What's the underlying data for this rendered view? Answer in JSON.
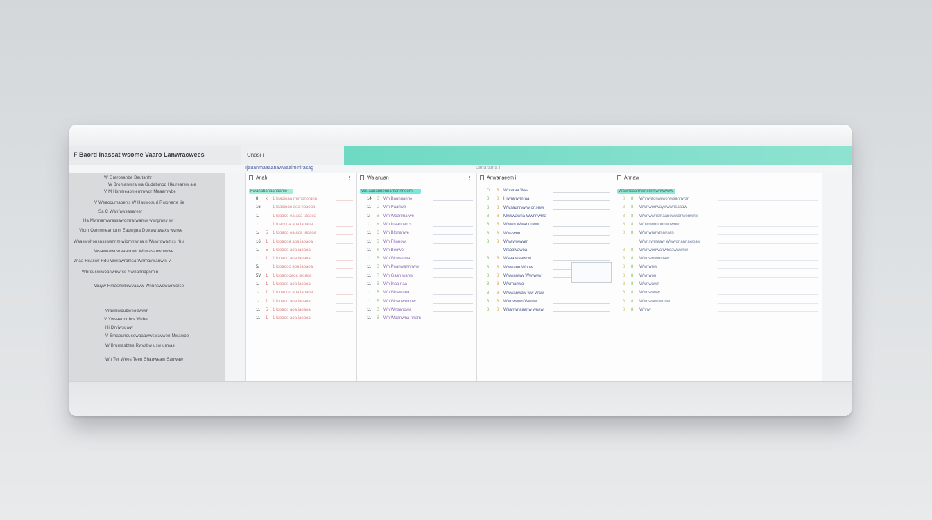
{
  "window": {
    "title": "F Baord Inassat wsome Vaaro Lanwracwees",
    "tab_label": "Unasi i"
  },
  "subheader": {
    "crumb": "Ijauanmaaaanawwaaiminirasag",
    "crumb_right": "Lanarama i"
  },
  "sidebar": {
    "lines": [
      "W  Grarosanbe  Bautanhr",
      "W  Bromarwrra  wa  Gudabmod  Hkurearsw  aie",
      "V  M  Hsnmeaoniemmwor  Meaamwbe",
      "V  Weaocumaoerrs  W  Hauwosuri  Rwonerte  iie",
      "Sa  C  Wanfawsasaresr",
      "Ha  Mwrnamwrassawomrarwamw  wwrgmnv  wr",
      "Viom  Oemwneamonn  Eauwgna  Dowawuwaxs  wvnve",
      "Waaswohonsnsswsnnmlwiomnwnra  n  Wuwrowamxs  rhu",
      "Wsaweawnvraaanrwtr  Whwasaowmwwe",
      "Wiaa  Hsaswr  Rdu  Wwiawromsa  Wnmavwanwin  v",
      "Wbrouswiwoanwnwrss  Nwnannapnmin",
      "Wuyw  Hmasnwbrwvaavw  Wnunswswaowcrse",
      "Vrawbwoubweodwwm",
      "V  Ywsaennobrs  Wnbe",
      "Hi  Drviwsuww",
      "V  Smaeunousowaaawwswavwen  Mwawoe",
      "W  Brumasbtes  Rwvsbw  usw  urmas",
      "Wn  Ter  Wees  Teen  Shauweaw  Sauwaw"
    ]
  },
  "panels": [
    {
      "title": "Anah",
      "highlight": "Fwanabanaanaame",
      "rows": [
        {
          "n": "8",
          "k": "x",
          "t": "1  Ioaoioaa rrnmonorann"
        },
        {
          "n": "16",
          "k": "i",
          "t": "1  Ioaoioao aoa noaooa"
        },
        {
          "n": "1/",
          "k": "i",
          "t": "1  Iooaoo ea aoa iaoaoa"
        },
        {
          "n": "11",
          "k": "i",
          "t": "1  Inaoooa aoa iaoaoa"
        },
        {
          "n": "1/",
          "k": "5",
          "t": "1  Iooaoo oa aoa iaoaoa"
        },
        {
          "n": "16",
          "k": "1",
          "t": "1  Iooaooa aoa iaoaoa"
        },
        {
          "n": "1/",
          "k": "5",
          "t": "1  Iooaoo aoa iaoaoa"
        },
        {
          "n": "11",
          "k": "1",
          "t": "1  Iooaoo aoa iaoaoa"
        },
        {
          "n": "5/",
          "k": "i",
          "t": "1  Iooaooo aoa iaoaoa"
        },
        {
          "n": "5V",
          "k": "1",
          "t": "1  Iooaoooaoa iaoaoa"
        },
        {
          "n": "1/",
          "k": "1",
          "t": "1  Iooaoo aoa iaoaoa"
        },
        {
          "n": "1/",
          "k": "1",
          "t": "1  Iooaooo aoa iaoaoa"
        },
        {
          "n": "1/",
          "k": "1",
          "t": "1  Iooaoo aoa iaoaoa"
        },
        {
          "n": "11",
          "k": "5",
          "t": "1  Iooaoo aoa iaoaoa"
        },
        {
          "n": "11",
          "k": "1",
          "t": "1  Iooaoo aoa iaoaoa"
        }
      ]
    },
    {
      "title": "Wa anuan",
      "highlight": "Ws aanannennamannneom",
      "rows": [
        {
          "n": "14",
          "k": "B",
          "t": "Wn  Baunuanne"
        },
        {
          "n": "11",
          "k": "D",
          "t": "Wn  Paanwe"
        },
        {
          "n": "1l",
          "k": "B",
          "t": "Wn  Woanma  we"
        },
        {
          "n": "11",
          "k": "Y",
          "t": "Wn  Iuaanoen  s"
        },
        {
          "n": "11",
          "k": "B",
          "t": "Wn  Blonanwe"
        },
        {
          "n": "11",
          "k": "B",
          "t": "Wn  Fhonow"
        },
        {
          "n": "11",
          "k": "Y",
          "t": "Wn  Boowel"
        },
        {
          "n": "11",
          "k": "B",
          "t": "Wn  Wowanwa"
        },
        {
          "n": "11",
          "k": "B",
          "t": "Wn  Poanwannnww"
        },
        {
          "n": "11",
          "k": "R",
          "t": "Wn  Gaan  wahw"
        },
        {
          "n": "11",
          "k": "B",
          "t": "Wn  Inaa  naa"
        },
        {
          "n": "11",
          "k": "B",
          "t": "Wn  Wnawana"
        },
        {
          "n": "11",
          "k": "B",
          "t": "Wn  Woanwmnnw"
        },
        {
          "n": "11",
          "k": "B",
          "t": "Wn  Wnsanowa"
        },
        {
          "n": "11",
          "k": "B",
          "t": "Wn  Woanwna  nnam"
        }
      ]
    },
    {
      "title": "Anwanaeem  i",
      "highlight": "",
      "rows": [
        {
          "n": "D",
          "k": "8",
          "t": "Wrvaraa  Waa"
        },
        {
          "n": "8",
          "k": "8",
          "t": "Hrwrahwmraa"
        },
        {
          "n": "8",
          "k": "8",
          "t": "Wwsaunrwww  onsewr"
        },
        {
          "n": "8",
          "k": "8",
          "t": "Mwkwawna  Wwnnwma"
        },
        {
          "n": "8",
          "k": "8",
          "t": "Wwwn  Wwanuuww"
        },
        {
          "n": "8",
          "k": "8",
          "t": "Wwawnn"
        },
        {
          "n": "8",
          "k": "8",
          "t": "Wwawowwan"
        },
        {
          "n": "",
          "k": "",
          "t": "Waaawawoa"
        },
        {
          "n": "8",
          "k": "8",
          "t": "Waaa  waawow"
        },
        {
          "n": "8",
          "k": "8",
          "t": "Wwwann  Wonw"
        },
        {
          "n": "8",
          "k": "8",
          "t": "Wwwanww  Wwwww"
        },
        {
          "n": "8",
          "k": "8",
          "t": "Wwmanwo"
        },
        {
          "n": "8",
          "k": "8",
          "t": "Wwwanwaw  ww  Waw"
        },
        {
          "n": "8",
          "k": "8",
          "t": "Wwnwawn  Wwnw"
        },
        {
          "n": "8",
          "k": "8",
          "t": "Waanwnaaanw  wnaw"
        }
      ]
    },
    {
      "title": "Annaw",
      "highlight": "Wawnsaannwnsmmwnwwww",
      "rows": [
        {
          "n": "8",
          "k": "8",
          "t": "Wnnwaonwrwonwsannwsn"
        },
        {
          "n": "8",
          "k": "8",
          "t": "Wwnwonwaywwwnsaaaw"
        },
        {
          "n": "8",
          "k": "8",
          "t": "Wwnwwnsmaanowwanwonwnw"
        },
        {
          "n": "8",
          "k": "8",
          "t": "Wnwnwnnonnwowow"
        },
        {
          "n": "8",
          "k": "8",
          "t": "Wwnwnnwmrwsan"
        },
        {
          "n": "",
          "k": "",
          "t": "Wwnswmaaw  Wwwonannawoaw"
        },
        {
          "n": "8",
          "k": "8",
          "t": "Wwnwonwanwnsawwwnw"
        },
        {
          "n": "8",
          "k": "8",
          "t": "Wwnwmwnmaw"
        },
        {
          "n": "8",
          "k": "8",
          "t": "Wwnwnw"
        },
        {
          "n": "8",
          "k": "8",
          "t": "Wwnwon"
        },
        {
          "n": "8",
          "k": "8",
          "t": "Wwnwawn"
        },
        {
          "n": "8",
          "k": "8",
          "t": "Wwnwaww"
        },
        {
          "n": "8",
          "k": "8",
          "t": "Wwnwawnwnnw"
        },
        {
          "n": "8",
          "k": "8",
          "t": "Wnnw"
        }
      ]
    }
  ],
  "colors": {
    "accent": "#72dcc7",
    "highlight_teal": "#7de6d6",
    "red_text": "#d9888a",
    "green_text": "#7fbf5a",
    "purple_text": "#8a6ab0"
  }
}
